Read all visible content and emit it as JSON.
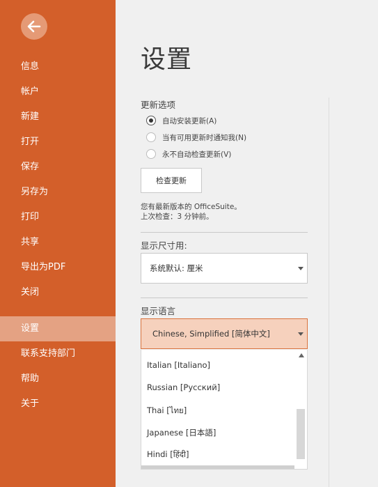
{
  "sidebar": {
    "back_icon": "arrow-left-icon",
    "items": [
      {
        "label": "信息"
      },
      {
        "label": "帐户"
      },
      {
        "label": "新建"
      },
      {
        "label": "打开"
      },
      {
        "label": "保存"
      },
      {
        "label": "另存为"
      },
      {
        "label": "打印"
      },
      {
        "label": "共享"
      },
      {
        "label": "导出为PDF"
      },
      {
        "label": "关闭"
      },
      {
        "label": "设置"
      },
      {
        "label": "联系支持部门"
      },
      {
        "label": "帮助"
      },
      {
        "label": "关于"
      }
    ],
    "active_item": "设置",
    "accent_color": "#d35f2a"
  },
  "main": {
    "title": "设置",
    "updates": {
      "label": "更新选项",
      "options": [
        {
          "label": "自动安装更新(A)",
          "checked": true
        },
        {
          "label": "当有可用更新时通知我(N)",
          "checked": false
        },
        {
          "label": "永不自动检查更新(V)",
          "checked": false
        }
      ],
      "check_button": "检查更新",
      "status_line1": "您有最新版本的 OfficeSuite。",
      "status_line2": "上次检查：3 分钟前。"
    },
    "units": {
      "label": "显示尺寸用:",
      "value": "系统默认: 厘米"
    },
    "language": {
      "label": "显示语言",
      "value": "Chinese, Simplified [简体中文]",
      "options": [
        "Italian [Italiano]",
        "Russian [Русский]",
        "Thai [ไทย]",
        "Japanese [日本語]",
        "Hindi [हिंदी]"
      ]
    }
  }
}
